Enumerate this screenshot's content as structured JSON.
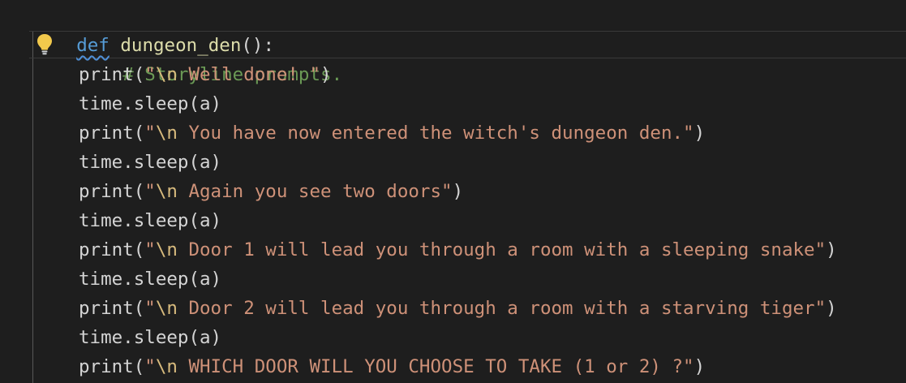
{
  "editor": {
    "function_def": {
      "keyword": "def",
      "name": "dungeon_den",
      "signature_tail": "():"
    },
    "comment": "# Storyline prompts.",
    "lightbulb_icon": "lightbulb-icon",
    "lines": [
      {
        "call": "print(",
        "quote_open": "\"",
        "escape": "\\n",
        "text": " Well done! ",
        "quote_close": "\"",
        "close": ")"
      },
      {
        "code": "time.sleep(a)"
      },
      {
        "call": "print(",
        "quote_open": "\"",
        "escape": "\\n",
        "text": " You have now entered the witch's dungeon den.",
        "quote_close": "\"",
        "close": ")"
      },
      {
        "code": "time.sleep(a)"
      },
      {
        "call": "print(",
        "quote_open": "\"",
        "escape": "\\n",
        "text": " Again you see two doors",
        "quote_close": "\"",
        "close": ")"
      },
      {
        "code": "time.sleep(a)"
      },
      {
        "call": "print(",
        "quote_open": "\"",
        "escape": "\\n",
        "text": " Door 1 will lead you through a room with a sleeping snake",
        "quote_close": "\"",
        "close": ")"
      },
      {
        "code": "time.sleep(a)"
      },
      {
        "call": "print(",
        "quote_open": "\"",
        "escape": "\\n",
        "text": " Door 2 will lead you through a room with a starving tiger",
        "quote_close": "\"",
        "close": ")"
      },
      {
        "code": "time.sleep(a)"
      },
      {
        "call": "print(",
        "quote_open": "\"",
        "escape": "\\n",
        "text": " WHICH DOOR WILL YOU CHOOSE TO TAKE (1 or 2) ?",
        "quote_close": "\"",
        "close": ")"
      }
    ]
  },
  "colors": {
    "background": "#1e1e1e",
    "keyword": "#569cd6",
    "string": "#ce9178",
    "escape": "#d7ba7d",
    "comment": "#6a9955",
    "text": "#d4d4d4",
    "lightbulb": "#f2c94c"
  }
}
